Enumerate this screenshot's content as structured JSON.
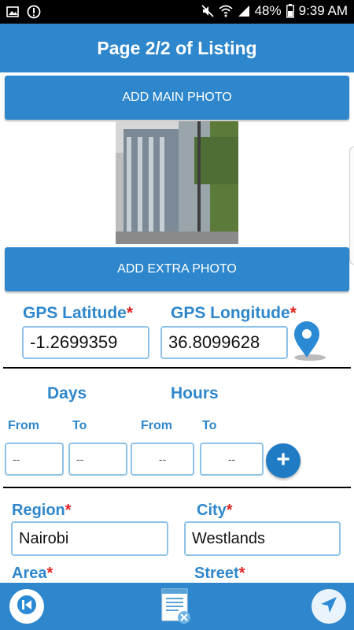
{
  "status_bar": {
    "battery": "48%",
    "time": "9:39 AM",
    "icons": [
      "image-icon",
      "alert-icon",
      "mute-icon",
      "wifi-icon",
      "signal-icon",
      "battery-icon"
    ]
  },
  "header": {
    "title": "Page 2/2 of Listing"
  },
  "photos": {
    "add_main_label": "ADD MAIN PHOTO",
    "add_extra_label": "ADD EXTRA PHOTO"
  },
  "gps": {
    "latitude_label": "GPS Latitude",
    "longitude_label": "GPS Longitude",
    "required_mark": "*",
    "latitude_value": "-1.2699359",
    "longitude_value": "36.8099628"
  },
  "schedule": {
    "days_label": "Days",
    "hours_label": "Hours",
    "from_label": "From",
    "to_label": "To",
    "days_from_value": "--",
    "days_to_value": "--",
    "hours_from_value": "--",
    "hours_to_value": "--",
    "add_label": "+"
  },
  "location": {
    "region_label": "Region",
    "city_label": "City",
    "area_label": "Area",
    "street_label": "Street",
    "region_value": "Nairobi",
    "city_value": "Westlands"
  },
  "colors": {
    "primary": "#2e87cc",
    "required": "#e02020",
    "field_border": "#8fc2e8"
  }
}
